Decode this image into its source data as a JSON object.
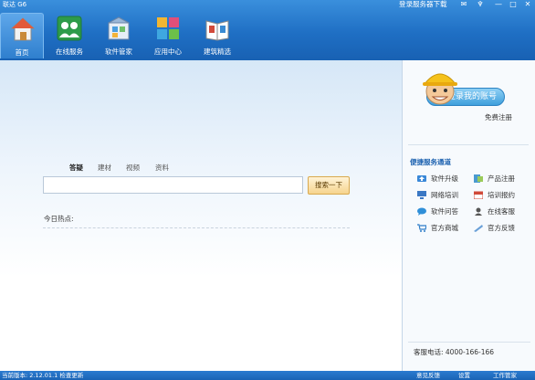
{
  "app": {
    "title": "联达 G6",
    "login_prompt": "登录服务器下载"
  },
  "window_controls": {
    "message": "✉",
    "skin": "♆",
    "minimize": "—",
    "maximize": "□",
    "close": "✕"
  },
  "nav": {
    "items": [
      {
        "label": "首页",
        "icon": "home-icon"
      },
      {
        "label": "在线服务",
        "icon": "users-icon"
      },
      {
        "label": "软件管家",
        "icon": "software-box-icon"
      },
      {
        "label": "应用中心",
        "icon": "app-grid-icon"
      },
      {
        "label": "建筑精选",
        "icon": "book-icon"
      }
    ],
    "active_index": 0
  },
  "search": {
    "tabs": [
      "答疑",
      "建材",
      "视频",
      "资料"
    ],
    "active_tab": 0,
    "value": "",
    "button": "搜索一下"
  },
  "hot": {
    "label": "今日热点:"
  },
  "side": {
    "login_button": "登录我的账号",
    "register": "免费注册",
    "quick_title": "便捷服务通道",
    "quick_items": [
      {
        "label": "软件升级",
        "icon": "upgrade-icon",
        "color": "#3a88d8"
      },
      {
        "label": "产品注册",
        "icon": "register-icon",
        "color": "#4a9ad0"
      },
      {
        "label": "网络培训",
        "icon": "monitor-icon",
        "color": "#3b78c4"
      },
      {
        "label": "培训报约",
        "icon": "calendar-icon",
        "color": "#d04a3a"
      },
      {
        "label": "软件问答",
        "icon": "chat-icon",
        "color": "#2f8fd8"
      },
      {
        "label": "在线客服",
        "icon": "agent-icon",
        "color": "#555555"
      },
      {
        "label": "官方商城",
        "icon": "cart-icon",
        "color": "#2d7cc8"
      },
      {
        "label": "官方反馈",
        "icon": "feedback-icon",
        "color": "#6aa0d8"
      }
    ],
    "phone": "客服电话: 4000-166-166"
  },
  "statusbar": {
    "left": "当前版本: 2.12.01.1  检查更新",
    "items": [
      "意见反馈",
      "设置",
      "工作管家"
    ]
  },
  "colors": {
    "header_blue": "#1f6fc4",
    "accent_orange": "#f6d48e",
    "link_blue": "#1d62b0"
  }
}
